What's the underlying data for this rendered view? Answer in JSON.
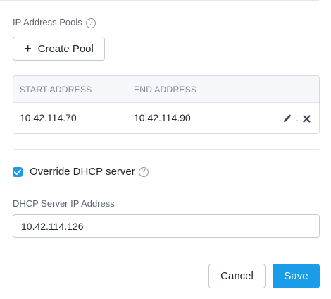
{
  "ip_pools": {
    "label": "IP Address Pools",
    "help_glyph": "?",
    "create_button": {
      "plus_glyph": "+",
      "label": "Create Pool"
    },
    "table": {
      "headers": {
        "start": "START ADDRESS",
        "end": "END ADDRESS"
      },
      "rows": [
        {
          "start": "10.42.114.70",
          "end": "10.42.114.90"
        }
      ],
      "action_separator": "·"
    }
  },
  "dhcp": {
    "override_checked": true,
    "override_label": "Override DHCP server",
    "help_glyph": "?",
    "server_ip_label": "DHCP Server IP Address",
    "server_ip_value": "10.42.114.126"
  },
  "footer": {
    "cancel_label": "Cancel",
    "save_label": "Save"
  },
  "colors": {
    "accent": "#1b9ce8",
    "border": "#c3cad2",
    "muted_text": "#7a8593"
  },
  "icons": [
    "help-icon",
    "plus-icon",
    "edit-icon",
    "delete-icon",
    "checkmark-icon"
  ]
}
